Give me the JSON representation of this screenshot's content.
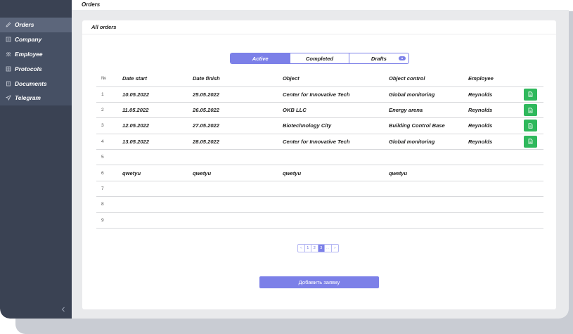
{
  "header": {
    "title": "Orders"
  },
  "sidebar": {
    "items": [
      {
        "label": "Orders",
        "icon": "pencil-icon",
        "active": true
      },
      {
        "label": "Company",
        "icon": "building-icon"
      },
      {
        "label": "Employee",
        "icon": "users-icon"
      },
      {
        "label": "Protocols",
        "icon": "grid-icon"
      },
      {
        "label": "Documents",
        "icon": "document-icon"
      },
      {
        "label": "Telegram",
        "icon": "send-icon"
      }
    ],
    "collapse_icon": "chevron-left-icon"
  },
  "card": {
    "title": "All orders"
  },
  "tabs": [
    {
      "label": "Active",
      "active": true
    },
    {
      "label": "Completed"
    },
    {
      "label": "Drafts"
    }
  ],
  "table": {
    "columns": [
      "№",
      "Date start",
      "Date finish",
      "Object",
      "Object control",
      "Employee"
    ],
    "rows": [
      {
        "num": "1",
        "date_start": "10.05.2022",
        "date_finish": "25.05.2022",
        "object": "Center for Innovative Tech",
        "object_control": "Global monitoring",
        "employee": "Reynolds",
        "doc": true
      },
      {
        "num": "2",
        "date_start": "11.05.2022",
        "date_finish": "26.05.2022",
        "object": "OKB LLC",
        "object_control": "Energy arena",
        "employee": "Reynolds",
        "doc": true
      },
      {
        "num": "3",
        "date_start": "12.05.2022",
        "date_finish": "27.05.2022",
        "object": "Biotechnology City",
        "object_control": "Building Control Base",
        "employee": "Reynolds",
        "doc": true
      },
      {
        "num": "4",
        "date_start": "13.05.2022",
        "date_finish": "28.05.2022",
        "object": "Center for Innovative Tech",
        "object_control": "Global monitoring",
        "employee": "Reynolds",
        "doc": true
      },
      {
        "num": "5",
        "date_start": "",
        "date_finish": "",
        "object": "",
        "object_control": "",
        "employee": "",
        "doc": false
      },
      {
        "num": "6",
        "date_start": "qwetyu",
        "date_finish": "qwetyu",
        "object": "qwetyu",
        "object_control": "qwetyu",
        "employee": "",
        "doc": false
      },
      {
        "num": "7",
        "date_start": "",
        "date_finish": "",
        "object": "",
        "object_control": "",
        "employee": "",
        "doc": false
      },
      {
        "num": "8",
        "date_start": "",
        "date_finish": "",
        "object": "",
        "object_control": "",
        "employee": "",
        "doc": false
      },
      {
        "num": "9",
        "date_start": "",
        "date_finish": "",
        "object": "",
        "object_control": "",
        "employee": "",
        "doc": false
      }
    ]
  },
  "pagination": {
    "prev": "<",
    "pages": [
      "1",
      "2",
      "3"
    ],
    "current": "3",
    "ellipsis": "...",
    "next": ">"
  },
  "add_button": {
    "label": "Добавить заявку"
  },
  "colors": {
    "accent": "#7c80e8",
    "sidebar": "#3a4253",
    "success": "#2fb85c"
  }
}
